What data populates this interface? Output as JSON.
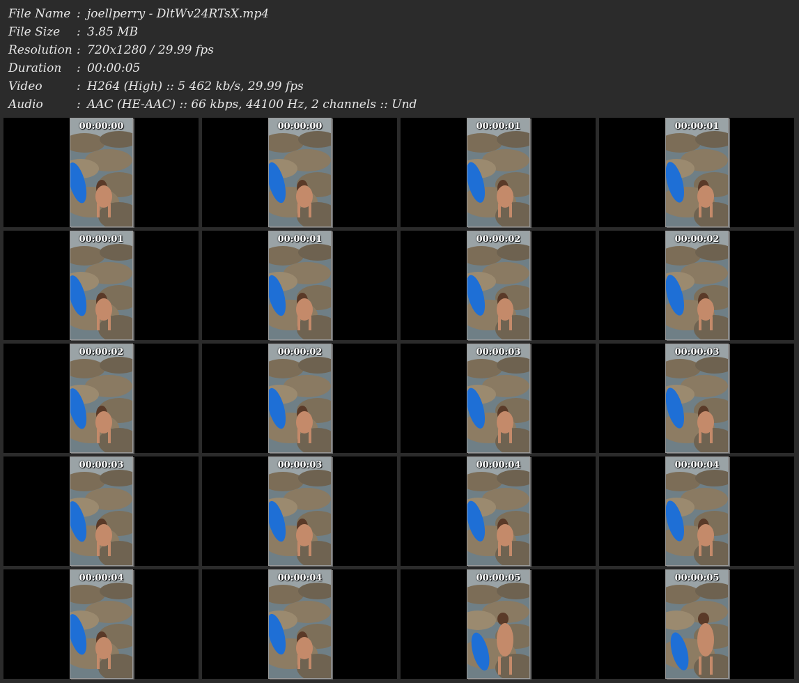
{
  "info": [
    {
      "key": "File Name",
      "value": "joellperry - DltWv24RTsX.mp4"
    },
    {
      "key": "File Size",
      "value": "3.85 MB"
    },
    {
      "key": "Resolution",
      "value": "720x1280 / 29.99 fps"
    },
    {
      "key": "Duration",
      "value": "00:00:05"
    },
    {
      "key": "Video",
      "value": "H264 (High) :: 5 462 kb/s, 29.99 fps"
    },
    {
      "key": "Audio",
      "value": "AAC (HE-AAC) :: 66 kbps, 44100 Hz, 2 channels :: Und"
    }
  ],
  "separator": ":",
  "thumbnails": [
    "00:00:00",
    "00:00:00",
    "00:00:01",
    "00:00:01",
    "00:00:01",
    "00:00:01",
    "00:00:02",
    "00:00:02",
    "00:00:02",
    "00:00:02",
    "00:00:03",
    "00:00:03",
    "00:00:03",
    "00:00:03",
    "00:00:04",
    "00:00:04",
    "00:00:04",
    "00:00:04",
    "00:00:05",
    "00:00:05"
  ],
  "colors": {
    "background": "#2b2b2b",
    "cell": "#000000",
    "text": "#e6e6e6",
    "kayak": "#1e6fd6",
    "rock": "#8a7a62",
    "water": "#6f7f86",
    "skin": "#c48a6a"
  }
}
